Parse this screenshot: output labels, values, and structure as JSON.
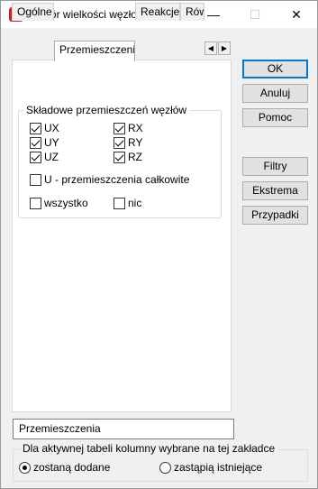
{
  "window": {
    "title": "Wybór wielkości węzłowych",
    "icon_letter": "R",
    "minimize_glyph": "—",
    "maximize_glyph": "☐",
    "close_glyph": "✕"
  },
  "tabs": [
    {
      "label": "Ogólne",
      "active": false
    },
    {
      "label": "Przemieszczenia",
      "active": true
    },
    {
      "label": "Reakcje",
      "active": false
    },
    {
      "label": "Rów",
      "active": false
    }
  ],
  "tab_scroll": {
    "left": "◀",
    "right": "▶"
  },
  "group": {
    "legend": "Składowe przemieszczeń węzłów",
    "components": [
      {
        "label": "UX",
        "checked": true
      },
      {
        "label": "RX",
        "checked": true
      },
      {
        "label": "UY",
        "checked": true
      },
      {
        "label": "RY",
        "checked": true
      },
      {
        "label": "UZ",
        "checked": true
      },
      {
        "label": "RZ",
        "checked": true
      }
    ],
    "total": {
      "label": "U - przemieszczenia całkowite",
      "checked": false
    },
    "all": {
      "label": "wszystko",
      "checked": false
    },
    "none": {
      "label": "nic",
      "checked": false
    }
  },
  "buttons": {
    "ok": "OK",
    "cancel": "Anuluj",
    "help": "Pomoc",
    "filters": "Filtry",
    "extrema": "Ekstrema",
    "cases": "Przypadki"
  },
  "name_field": {
    "value": "Przemieszczenia"
  },
  "columns_group": {
    "legend": "Dla aktywnej tabeli kolumny wybrane na tej zakładce",
    "options": [
      {
        "label": "zostaną dodane",
        "checked": true
      },
      {
        "label": "zastąpią istniejące",
        "checked": false
      }
    ]
  },
  "colors": {
    "accent": "#0078d7",
    "app_icon": "#d11a2a"
  }
}
